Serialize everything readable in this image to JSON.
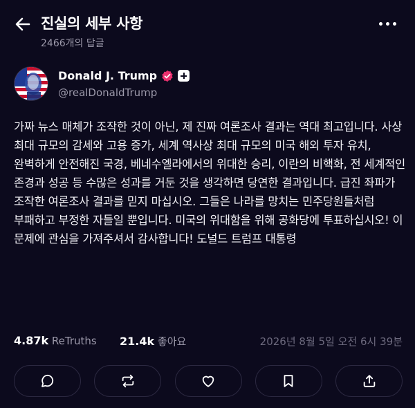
{
  "header": {
    "title": "진실의 세부 사항",
    "replies": "2466개의 답글",
    "icons": {
      "back": "arrow-left-icon",
      "more": "more-horizontal-icon"
    }
  },
  "author": {
    "name": "Donald J. Trump",
    "handle": "@realDonaldTrump",
    "icons": {
      "verified": "verified-badge-icon",
      "plus": "plus-badge-icon"
    }
  },
  "post": {
    "text": "가짜 뉴스 매체가 조작한 것이 아닌, 제 진짜 여론조사 결과는 역대 최고입니다. 사상 최대 규모의 감세와 고용 증가, 세계 역사상 최대 규모의 미국 해외 투자 유치, 완벽하게 안전해진 국경, 베네수엘라에서의 위대한 승리, 이란의 비핵화, 전 세계적인 존경과 성공 등 수많은 성과를 거둔 것을 생각하면 당연한 결과입니다. 급진 좌파가 조작한 여론조사 결과를 믿지 마십시오. 그들은 나라를 망치는 민주당원들처럼 부패하고 부정한 자들일 뿐입니다. 미국의 위대함을 위해 공화당에 투표하십시오! 이 문제에 관심을 가져주셔서 감사합니다! 도널드 트럼프 대통령"
  },
  "stats": {
    "retruths_count": "4.87k",
    "retruths_label": "ReTruths",
    "likes_count": "21.4k",
    "likes_label": "좋아요",
    "timestamp": "2026년 8월 5일 오전 6시 39분"
  },
  "actions": [
    {
      "name": "reply",
      "icon": "comment-icon"
    },
    {
      "name": "retruth",
      "icon": "repost-icon"
    },
    {
      "name": "like",
      "icon": "heart-icon"
    },
    {
      "name": "bookmark",
      "icon": "bookmark-icon"
    },
    {
      "name": "share",
      "icon": "share-icon"
    }
  ],
  "colors": {
    "background": "#0c0a1d",
    "muted_text": "#9d9aab",
    "verified_badge": "#e8306e",
    "border": "#2b2840"
  }
}
